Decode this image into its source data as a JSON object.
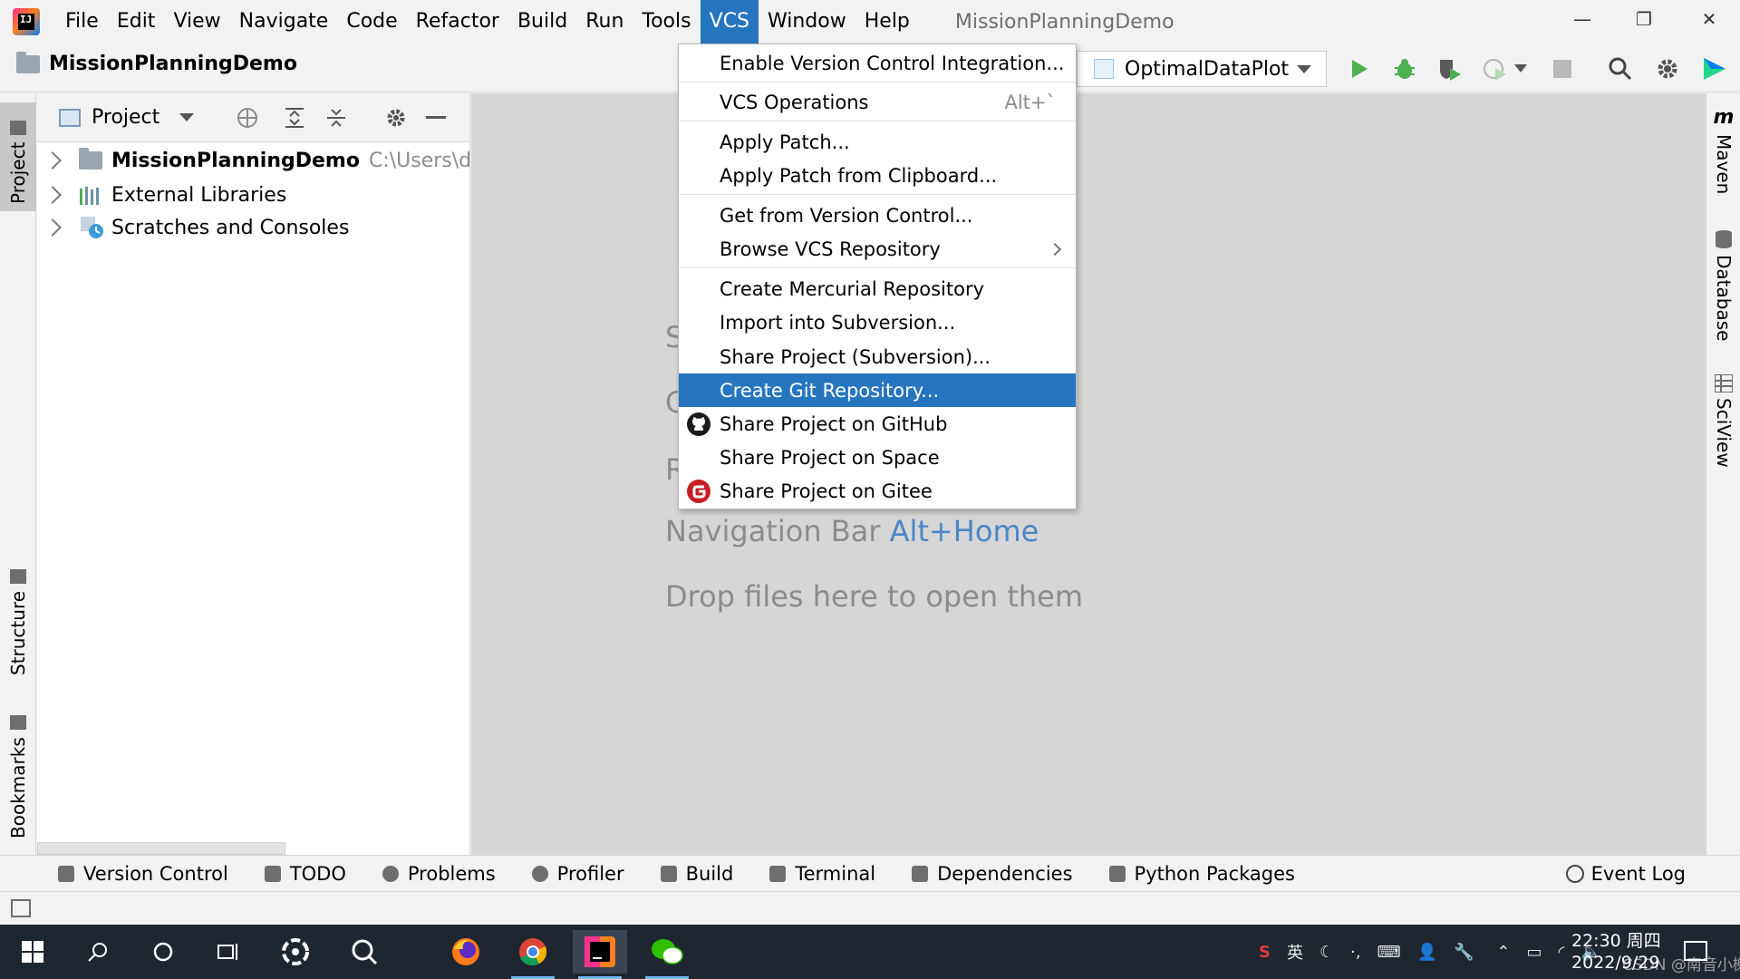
{
  "menubar": {
    "items": [
      "File",
      "Edit",
      "View",
      "Navigate",
      "Code",
      "Refactor",
      "Build",
      "Run",
      "Tools",
      "VCS",
      "Window",
      "Help"
    ],
    "active": "VCS",
    "window_title": "MissionPlanningDemo",
    "logo_letters": "IJ"
  },
  "window_controls": {
    "minimize": "—",
    "restore": "❐",
    "close": "✕"
  },
  "navbar": {
    "breadcrumb": "MissionPlanningDemo",
    "run_config": "OptimalDataPlot"
  },
  "left_stripe": {
    "tabs": [
      "Project",
      "Structure",
      "Bookmarks"
    ]
  },
  "project_panel": {
    "title": "Project",
    "tree": [
      {
        "label": "MissionPlanningDemo",
        "path": "C:\\Users\\dengf",
        "bold": true
      },
      {
        "label": "External Libraries",
        "path": "",
        "bold": false
      },
      {
        "label": "Scratches and Consoles",
        "path": "",
        "bold": false
      }
    ]
  },
  "editor": {
    "partial_hints": [
      "S",
      "G",
      "R"
    ],
    "nav_hint_text": "Navigation Bar",
    "nav_hint_shortcut": "Alt+Home",
    "drop_hint": "Drop files here to open them"
  },
  "right_stripe": {
    "tabs": [
      "Maven",
      "Database",
      "SciView"
    ]
  },
  "vcs_menu": {
    "items": [
      {
        "label": "Enable Version Control Integration...",
        "shortcut": "",
        "icon": ""
      },
      {
        "label": "VCS Operations",
        "shortcut": "Alt+`",
        "icon": ""
      },
      {
        "label": "Apply Patch...",
        "shortcut": "",
        "icon": ""
      },
      {
        "label": "Apply Patch from Clipboard...",
        "shortcut": "",
        "icon": ""
      },
      {
        "label": "Get from Version Control...",
        "shortcut": "",
        "icon": ""
      },
      {
        "label": "Browse VCS Repository",
        "shortcut": "",
        "icon": "",
        "submenu": true
      },
      {
        "label": "Create Mercurial Repository",
        "shortcut": "",
        "icon": ""
      },
      {
        "label": "Import into Subversion...",
        "shortcut": "",
        "icon": ""
      },
      {
        "label": "Share Project (Subversion)...",
        "shortcut": "",
        "icon": ""
      },
      {
        "label": "Create Git Repository...",
        "shortcut": "",
        "icon": "",
        "highlighted": true
      },
      {
        "label": "Share Project on GitHub",
        "shortcut": "",
        "icon": "github-icon"
      },
      {
        "label": "Share Project on Space",
        "shortcut": "",
        "icon": ""
      },
      {
        "label": "Share Project on Gitee",
        "shortcut": "",
        "icon": "gitee-icon"
      }
    ]
  },
  "bottom_bar": {
    "tools": [
      "Version Control",
      "TODO",
      "Problems",
      "Profiler",
      "Build",
      "Terminal",
      "Dependencies",
      "Python Packages"
    ],
    "event_log": "Event Log"
  },
  "taskbar": {
    "ime_label": "英",
    "time": "22:30 周四",
    "date": "2022/9/29",
    "watermark": "CSDN @南音小榭"
  },
  "colors": {
    "accent": "#2675bf",
    "editor_bg": "#d6d6d6",
    "shortcut_blue": "#4a86c8",
    "run_green": "#4caf50",
    "taskbar_bg": "#1e2630"
  }
}
